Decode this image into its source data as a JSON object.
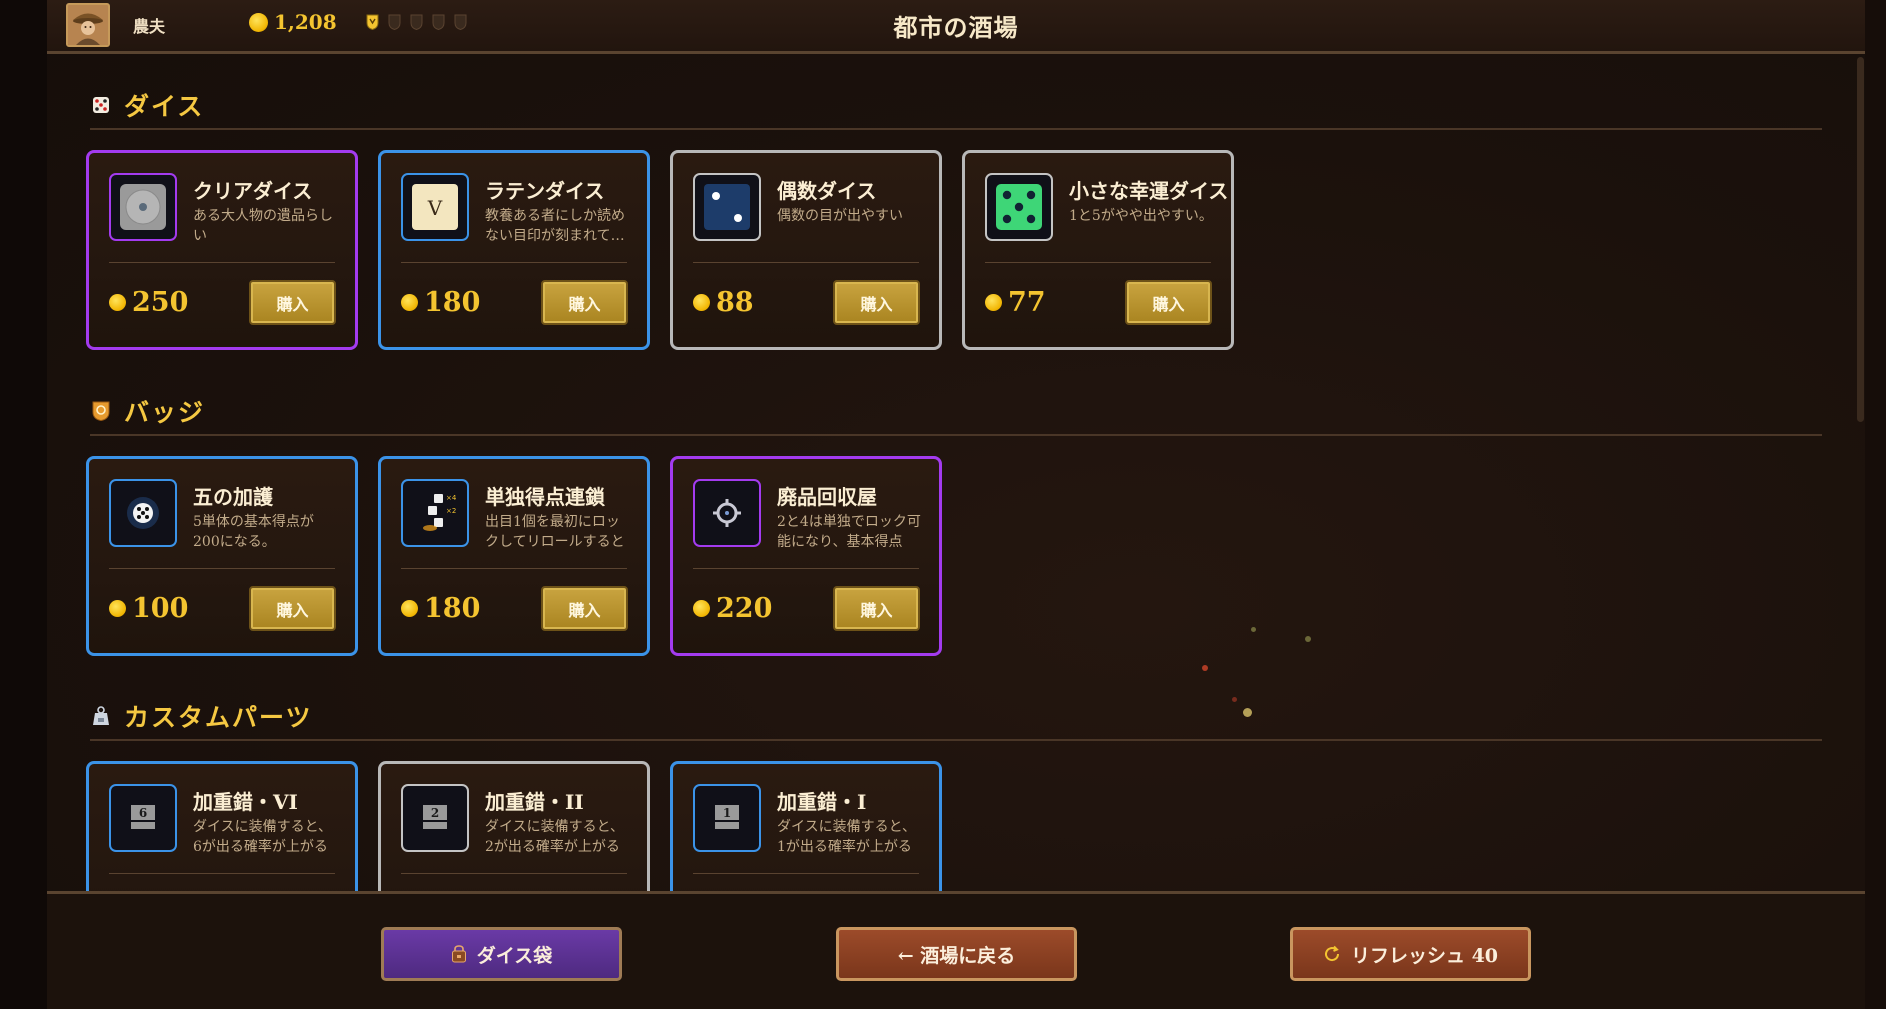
{
  "header": {
    "player_name": "農夫",
    "gold": "1,208",
    "title": "都市の酒場"
  },
  "colors": {
    "gold": "#f4c430",
    "epic": "#a33bef",
    "rare": "#3b93e8",
    "common": "#b8b8b8"
  },
  "sections": [
    {
      "title": "ダイス",
      "icon": "dice-icon",
      "items": [
        {
          "name": "クリアダイス",
          "desc": "ある大人物の遺品らしい",
          "price": "250",
          "rarity": "epic",
          "icon": "clear-die-icon"
        },
        {
          "name": "ラテンダイス",
          "desc": "教養ある者にしか読めない目印が刻まれている",
          "price": "180",
          "rarity": "rare",
          "icon": "latin-die-icon",
          "glyph": "V"
        },
        {
          "name": "偶数ダイス",
          "desc": "偶数の目が出やすい",
          "price": "88",
          "rarity": "common",
          "icon": "even-die-icon"
        },
        {
          "name": "小さな幸運ダイス",
          "desc": "1と5がやや出やすい。",
          "price": "77",
          "rarity": "common",
          "icon": "lucky-die-icon"
        }
      ]
    },
    {
      "title": "バッジ",
      "icon": "badge-icon",
      "items": [
        {
          "name": "五の加護",
          "desc": "5単体の基本得点が200になる。",
          "price": "100",
          "rarity": "rare",
          "icon": "five-blessing-icon"
        },
        {
          "name": "単独得点連鎖",
          "desc": "出目1個を最初にロックしてリロールすると",
          "price": "180",
          "rarity": "rare",
          "icon": "chain-icon",
          "mult_a": "×4",
          "mult_b": "×2"
        },
        {
          "name": "廃品回収屋",
          "desc": "2と4は単独でロック可能になり、基本得点",
          "price": "220",
          "rarity": "epic",
          "icon": "scrap-gear-icon"
        }
      ]
    },
    {
      "title": "カスタムパーツ",
      "icon": "weight-icon",
      "items": [
        {
          "name": "加重錯・VI",
          "desc": "ダイスに装備すると、6が出る確率が上がる",
          "price": "",
          "rarity": "rare",
          "icon": "weight-6-icon",
          "glyph": "6"
        },
        {
          "name": "加重錯・II",
          "desc": "ダイスに装備すると、2が出る確率が上がる",
          "price": "",
          "rarity": "common",
          "icon": "weight-2-icon",
          "glyph": "2"
        },
        {
          "name": "加重錯・I",
          "desc": "ダイスに装備すると、1が出る確率が上がる",
          "price": "",
          "rarity": "rare",
          "icon": "weight-1-icon",
          "glyph": "1"
        }
      ]
    }
  ],
  "buy_label": "購入",
  "footer": {
    "bag_label": "ダイス袋",
    "back_label": "← 酒場に戻る",
    "refresh_label": "リフレッシュ 40"
  }
}
